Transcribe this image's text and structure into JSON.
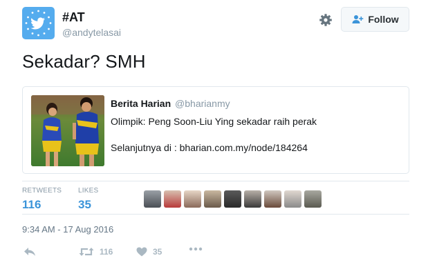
{
  "profile": {
    "name": "#AT",
    "handle": "@andytelasai",
    "avatar_icon": "twitter-bird-icon",
    "avatar_color": "#55acee"
  },
  "header": {
    "follow_label": "Follow",
    "settings_icon": "gear-icon",
    "follow_icon": "add-user-icon"
  },
  "tweet": {
    "text": "Sekadar? SMH"
  },
  "quoted": {
    "author_name": "Berita Harian",
    "author_handle": "@bharianmy",
    "line1": "Olimpik: Peng Soon-Liu Ying sekadar raih perak",
    "line2": "Selanjutnya di : bharian.com.my/node/184264"
  },
  "stats": {
    "retweets_label": "RETWEETS",
    "retweets_count": "116",
    "likes_label": "LIKES",
    "likes_count": "35",
    "count_color": "#3b94d9"
  },
  "timestamp": "9:34 AM - 17 Aug 2016",
  "actions": {
    "reply_icon": "reply-icon",
    "retweet_icon": "retweet-icon",
    "retweet_count": "116",
    "like_icon": "heart-icon",
    "like_count": "35",
    "more_icon": "more-dots-icon"
  }
}
